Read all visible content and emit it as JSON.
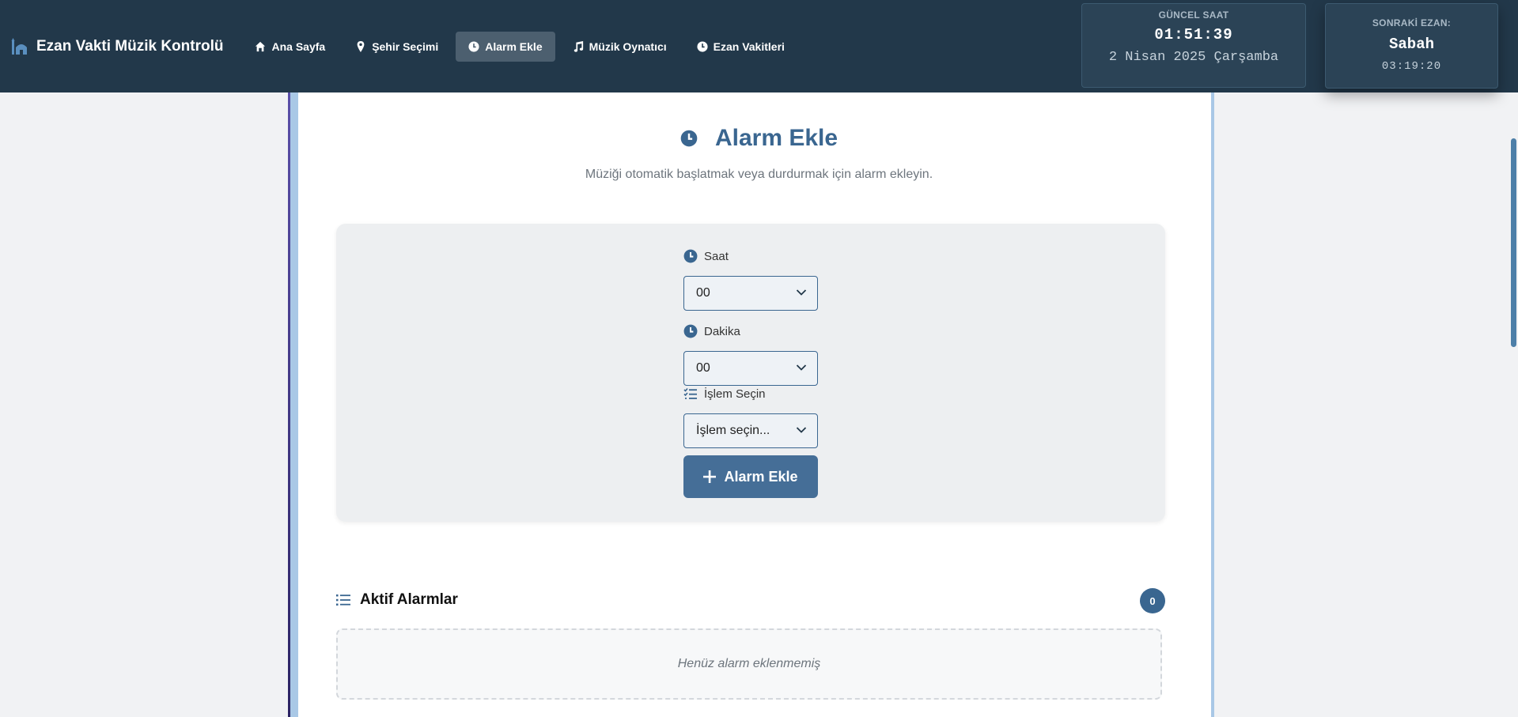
{
  "navbar": {
    "brand": "Ezan Vakti Müzik Kontrolü",
    "items": [
      {
        "label": "Ana Sayfa",
        "icon": "home-icon",
        "active": false
      },
      {
        "label": "Şehir Seçimi",
        "icon": "map-pin-icon",
        "active": false
      },
      {
        "label": "Alarm Ekle",
        "icon": "clock-icon",
        "active": true
      },
      {
        "label": "Müzik Oynatıcı",
        "icon": "music-icon",
        "active": false
      },
      {
        "label": "Ezan Vakitleri",
        "icon": "clock-icon",
        "active": false
      }
    ]
  },
  "clock": {
    "label": "GÜNCEL SAAT",
    "time": "01:51:39",
    "date": "2 Nisan 2025 Çarşamba"
  },
  "next_prayer": {
    "label": "SONRAKİ EZAN:",
    "name": "Sabah",
    "time": "03:19:20"
  },
  "page": {
    "title": "Alarm Ekle",
    "subtitle": "Müziği otomatik başlatmak veya durdurmak için alarm ekleyin."
  },
  "form": {
    "hour_label": "Saat",
    "hour_value": "00",
    "minute_label": "Dakika",
    "minute_value": "00",
    "action_label": "İşlem Seçin",
    "action_value": "İşlem seçin...",
    "submit_label": "Alarm Ekle"
  },
  "alarms": {
    "title": "Aktif Alarmlar",
    "count": "0",
    "empty_text": "Henüz alarm eklenmemiş"
  },
  "colors": {
    "navbar": "#22384a",
    "accent": "#3a6690",
    "button": "#456e97",
    "card_border": "#a9c8e6"
  }
}
